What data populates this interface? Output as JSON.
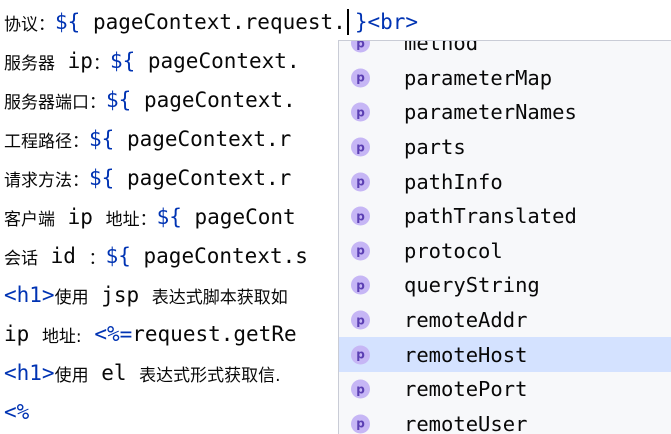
{
  "code_lines": [
    {
      "prefix": "协议：",
      "el_open": "${",
      "expr": " pageContext.request.",
      "el_close": "}",
      "tag": "<br>"
    },
    {
      "prefix": "服务器",
      "code": " ip",
      "prefix2": "：",
      "el_open": "${",
      "expr": " pageContext."
    },
    {
      "prefix": "服务器端口：",
      "el_open": "${",
      "expr": " pageContext."
    },
    {
      "prefix": "工程路径：",
      "el_open": "${",
      "expr": " pageContext.r"
    },
    {
      "prefix": "请求方法：",
      "el_open": "${",
      "expr": " pageContext.r"
    },
    {
      "prefix": "客户端",
      "code": " ip ",
      "prefix2": "地址：",
      "el_open": "${",
      "expr": " pageCont"
    },
    {
      "prefix": "会话",
      "code": " id ",
      "prefix2": "：",
      "el_open": "${",
      "expr": " pageContext.s"
    },
    {
      "tag": "<h1>",
      "prefix": "使用",
      "code": " jsp ",
      "prefix2": "表达式脚本获取如"
    },
    {
      "code_start": "ip ",
      "prefix": "地址:",
      "el_open": " <%=",
      "expr": "request.getRe"
    },
    {
      "tag": "<h1>",
      "prefix": "使用",
      "code": " el ",
      "prefix2": "表达式形式获取信."
    },
    {
      "tag": "<%"
    }
  ],
  "completion": {
    "icon_letter": "p",
    "items": [
      "method",
      "parameterMap",
      "parameterNames",
      "parts",
      "pathInfo",
      "pathTranslated",
      "protocol",
      "queryString",
      "remoteAddr",
      "remoteHost",
      "remotePort",
      "remoteUser"
    ],
    "selected": "remoteHost"
  }
}
